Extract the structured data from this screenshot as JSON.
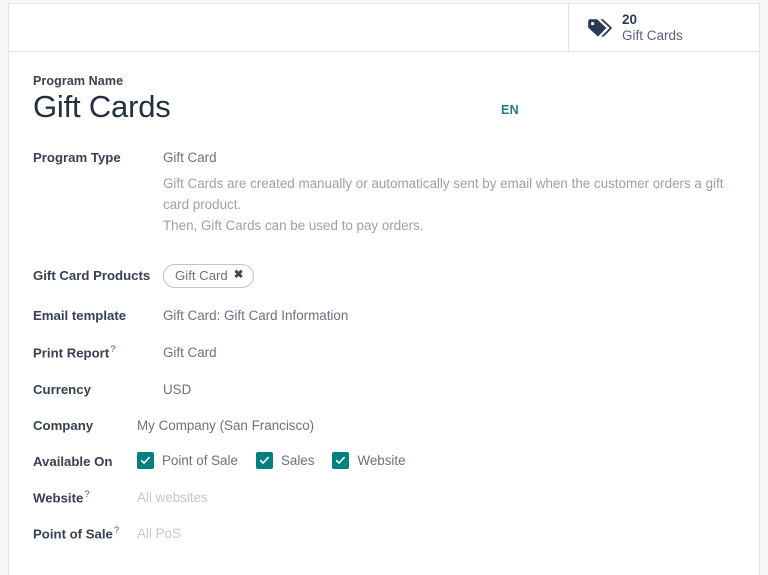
{
  "smart_buttons": [
    {
      "icon": "price-tag-icon",
      "value": "20",
      "label": "Gift Cards"
    }
  ],
  "form": {
    "title_label": "Program Name",
    "title_value": "Gift Cards",
    "language_badge": "EN",
    "program_type": {
      "label": "Program Type",
      "value": "Gift Card",
      "helper_line_1": "Gift Cards are created manually or automatically sent by email when the customer orders a gift card product.",
      "helper_line_2": "Then, Gift Cards can be used to pay orders."
    },
    "gift_card_products": {
      "label": "Gift Card Products",
      "tags": [
        {
          "text": "Gift Card",
          "remove_icon": "close-icon"
        }
      ]
    },
    "email_template": {
      "label": "Email template",
      "value": "Gift Card: Gift Card Information"
    },
    "print_report": {
      "label": "Print Report",
      "help_marker": "?",
      "value": "Gift Card"
    },
    "currency": {
      "label": "Currency",
      "value": "USD"
    },
    "company": {
      "label": "Company",
      "value": "My Company (San Francisco)"
    },
    "available_on": {
      "label": "Available On",
      "options": [
        {
          "label": "Point of Sale",
          "checked": true
        },
        {
          "label": "Sales",
          "checked": true
        },
        {
          "label": "Website",
          "checked": true
        }
      ]
    },
    "website": {
      "label": "Website",
      "help_marker": "?",
      "placeholder": "All websites"
    },
    "point_of_sale": {
      "label": "Point of Sale",
      "help_marker": "?",
      "placeholder": "All PoS"
    }
  },
  "colors": {
    "accent_teal": "#00807f",
    "lang_badge": "#1f7d8c",
    "icon_navy": "#2b3a52"
  }
}
